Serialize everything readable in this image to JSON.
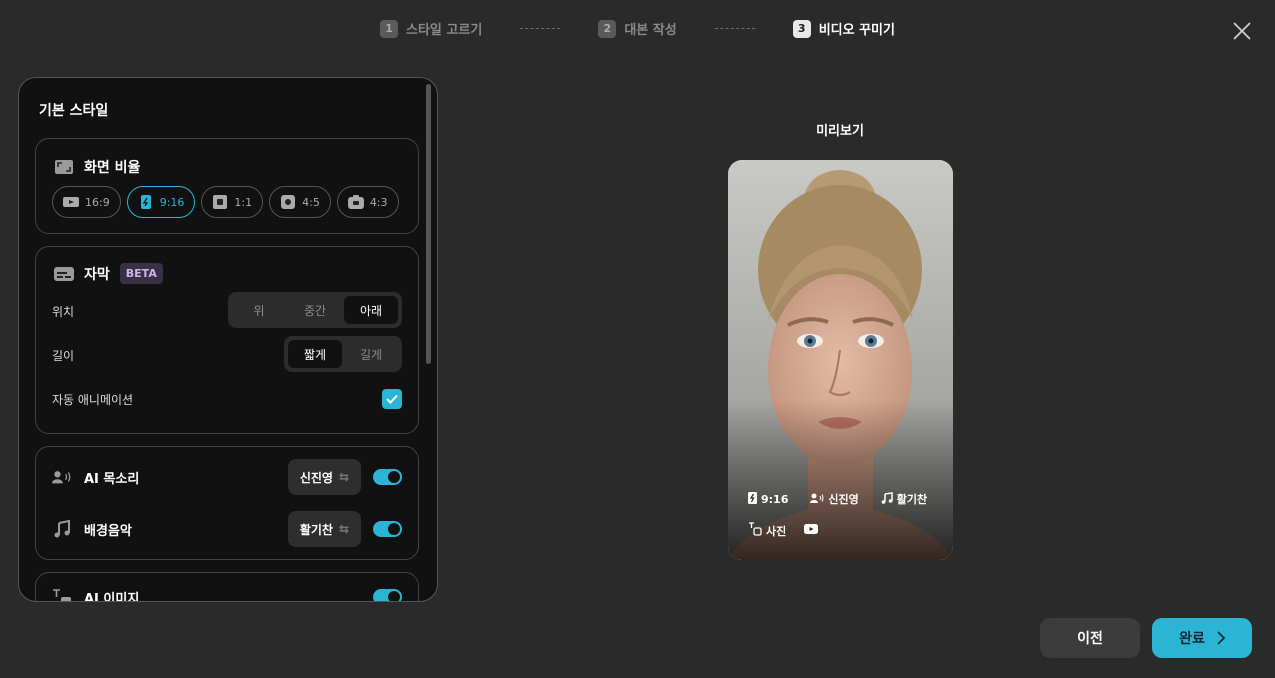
{
  "stepper": {
    "steps": [
      {
        "num": "1",
        "label": "스타일 고르기"
      },
      {
        "num": "2",
        "label": "대본 작성"
      },
      {
        "num": "3",
        "label": "비디오 꾸미기"
      }
    ],
    "active_step": 3
  },
  "panel": {
    "title": "기본 스타일",
    "ratio": {
      "title": "화면 비율",
      "options": [
        "16:9",
        "9:16",
        "1:1",
        "4:5",
        "4:3"
      ],
      "selected": "9:16"
    },
    "subtitle": {
      "title": "자막",
      "badge": "BETA",
      "position_label": "위치",
      "position_options": [
        "위",
        "중간",
        "아래"
      ],
      "position_selected": "아래",
      "length_label": "길이",
      "length_options": [
        "짧게",
        "길게"
      ],
      "length_selected": "짧게",
      "animation_label": "자동 애니메이션",
      "animation_checked": true
    },
    "voice": {
      "label": "AI 목소리",
      "value": "신진영",
      "enabled": true
    },
    "music": {
      "label": "배경음악",
      "value": "활기찬",
      "enabled": true
    },
    "ai_image": {
      "label": "AI 이미지",
      "enabled": true
    }
  },
  "preview": {
    "title": "미리보기",
    "tags_row1": [
      "9:16",
      "신진영",
      "활기찬"
    ],
    "tags_row2": [
      "사진"
    ]
  },
  "buttons": {
    "prev": "이전",
    "done": "완료"
  },
  "colors": {
    "accent": "#2ab5d6",
    "background": "#2a2a2a",
    "panel": "#111111"
  }
}
